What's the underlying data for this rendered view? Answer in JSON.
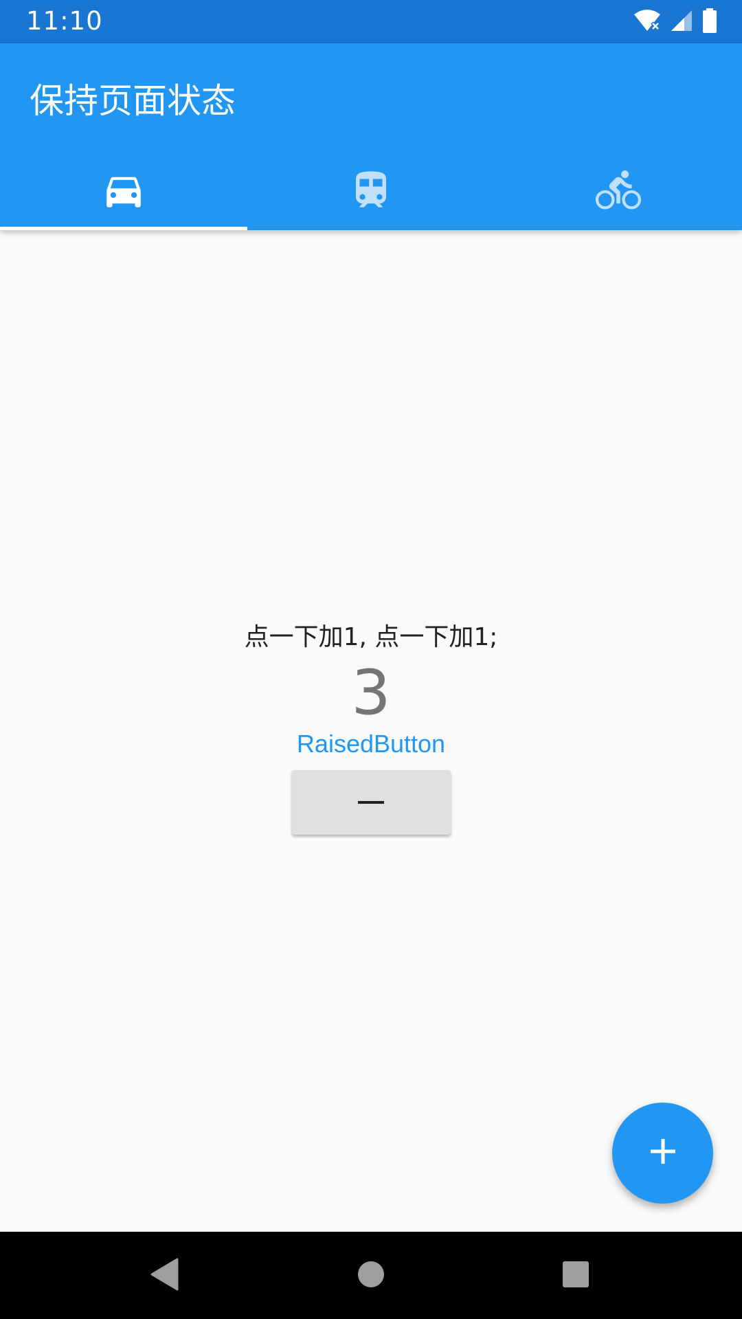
{
  "status_bar": {
    "time": "11:10",
    "icons": [
      "wifi-icon",
      "signal-icon",
      "battery-icon"
    ]
  },
  "app_bar": {
    "title": "保持页面状态",
    "color": "#2196f3"
  },
  "tabs": [
    {
      "icon": "car-icon",
      "active": true
    },
    {
      "icon": "train-icon",
      "active": false
    },
    {
      "icon": "bike-icon",
      "active": false
    }
  ],
  "content": {
    "hint_text": "点一下加1, 点一下加1;",
    "counter": "3",
    "link_label": "RaisedButton",
    "button_label": "—"
  },
  "fab": {
    "icon": "plus-icon"
  },
  "nav_bar": {
    "buttons": [
      "back-icon",
      "home-icon",
      "recents-icon"
    ]
  },
  "colors": {
    "primary": "#2196f3",
    "primary_dark": "#1976d2",
    "background": "#fafafa",
    "button": "#e0e0e0"
  }
}
